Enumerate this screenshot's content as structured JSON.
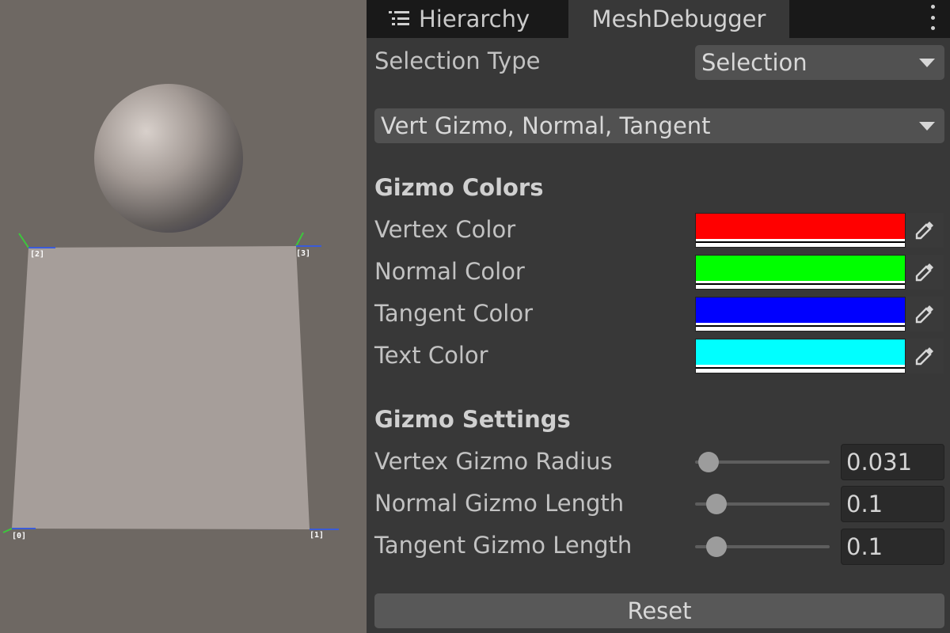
{
  "tabs": {
    "hierarchy": {
      "label": "Hierarchy",
      "icon": "list-icon"
    },
    "mesh_debugger": {
      "label": "MeshDebugger"
    },
    "menu_icon": "kebab-menu-icon"
  },
  "scene": {
    "vertex_labels": [
      "[0]",
      "[1]",
      "[2]",
      "[3]"
    ],
    "background": "#6e6863",
    "quad_color": "#a69e9a"
  },
  "inspector": {
    "selection_type": {
      "label": "Selection Type",
      "value": "Selection"
    },
    "gizmo_mode": {
      "value": "Vert Gizmo, Normal, Tangent"
    },
    "gizmo_colors": {
      "heading": "Gizmo Colors",
      "items": [
        {
          "label": "Vertex Color",
          "color": "#ff0000"
        },
        {
          "label": "Normal Color",
          "color": "#00ff00"
        },
        {
          "label": "Tangent Color",
          "color": "#0000ff"
        },
        {
          "label": "Text Color",
          "color": "#00ffff"
        }
      ],
      "picker_icon": "eyedropper-icon"
    },
    "gizmo_settings": {
      "heading": "Gizmo Settings",
      "items": [
        {
          "label": "Vertex Gizmo Radius",
          "value": "0.031",
          "fraction": 0.1
        },
        {
          "label": "Normal Gizmo Length",
          "value": "0.1",
          "fraction": 0.16
        },
        {
          "label": "Tangent Gizmo Length",
          "value": "0.1",
          "fraction": 0.16
        }
      ]
    },
    "reset_label": "Reset"
  }
}
